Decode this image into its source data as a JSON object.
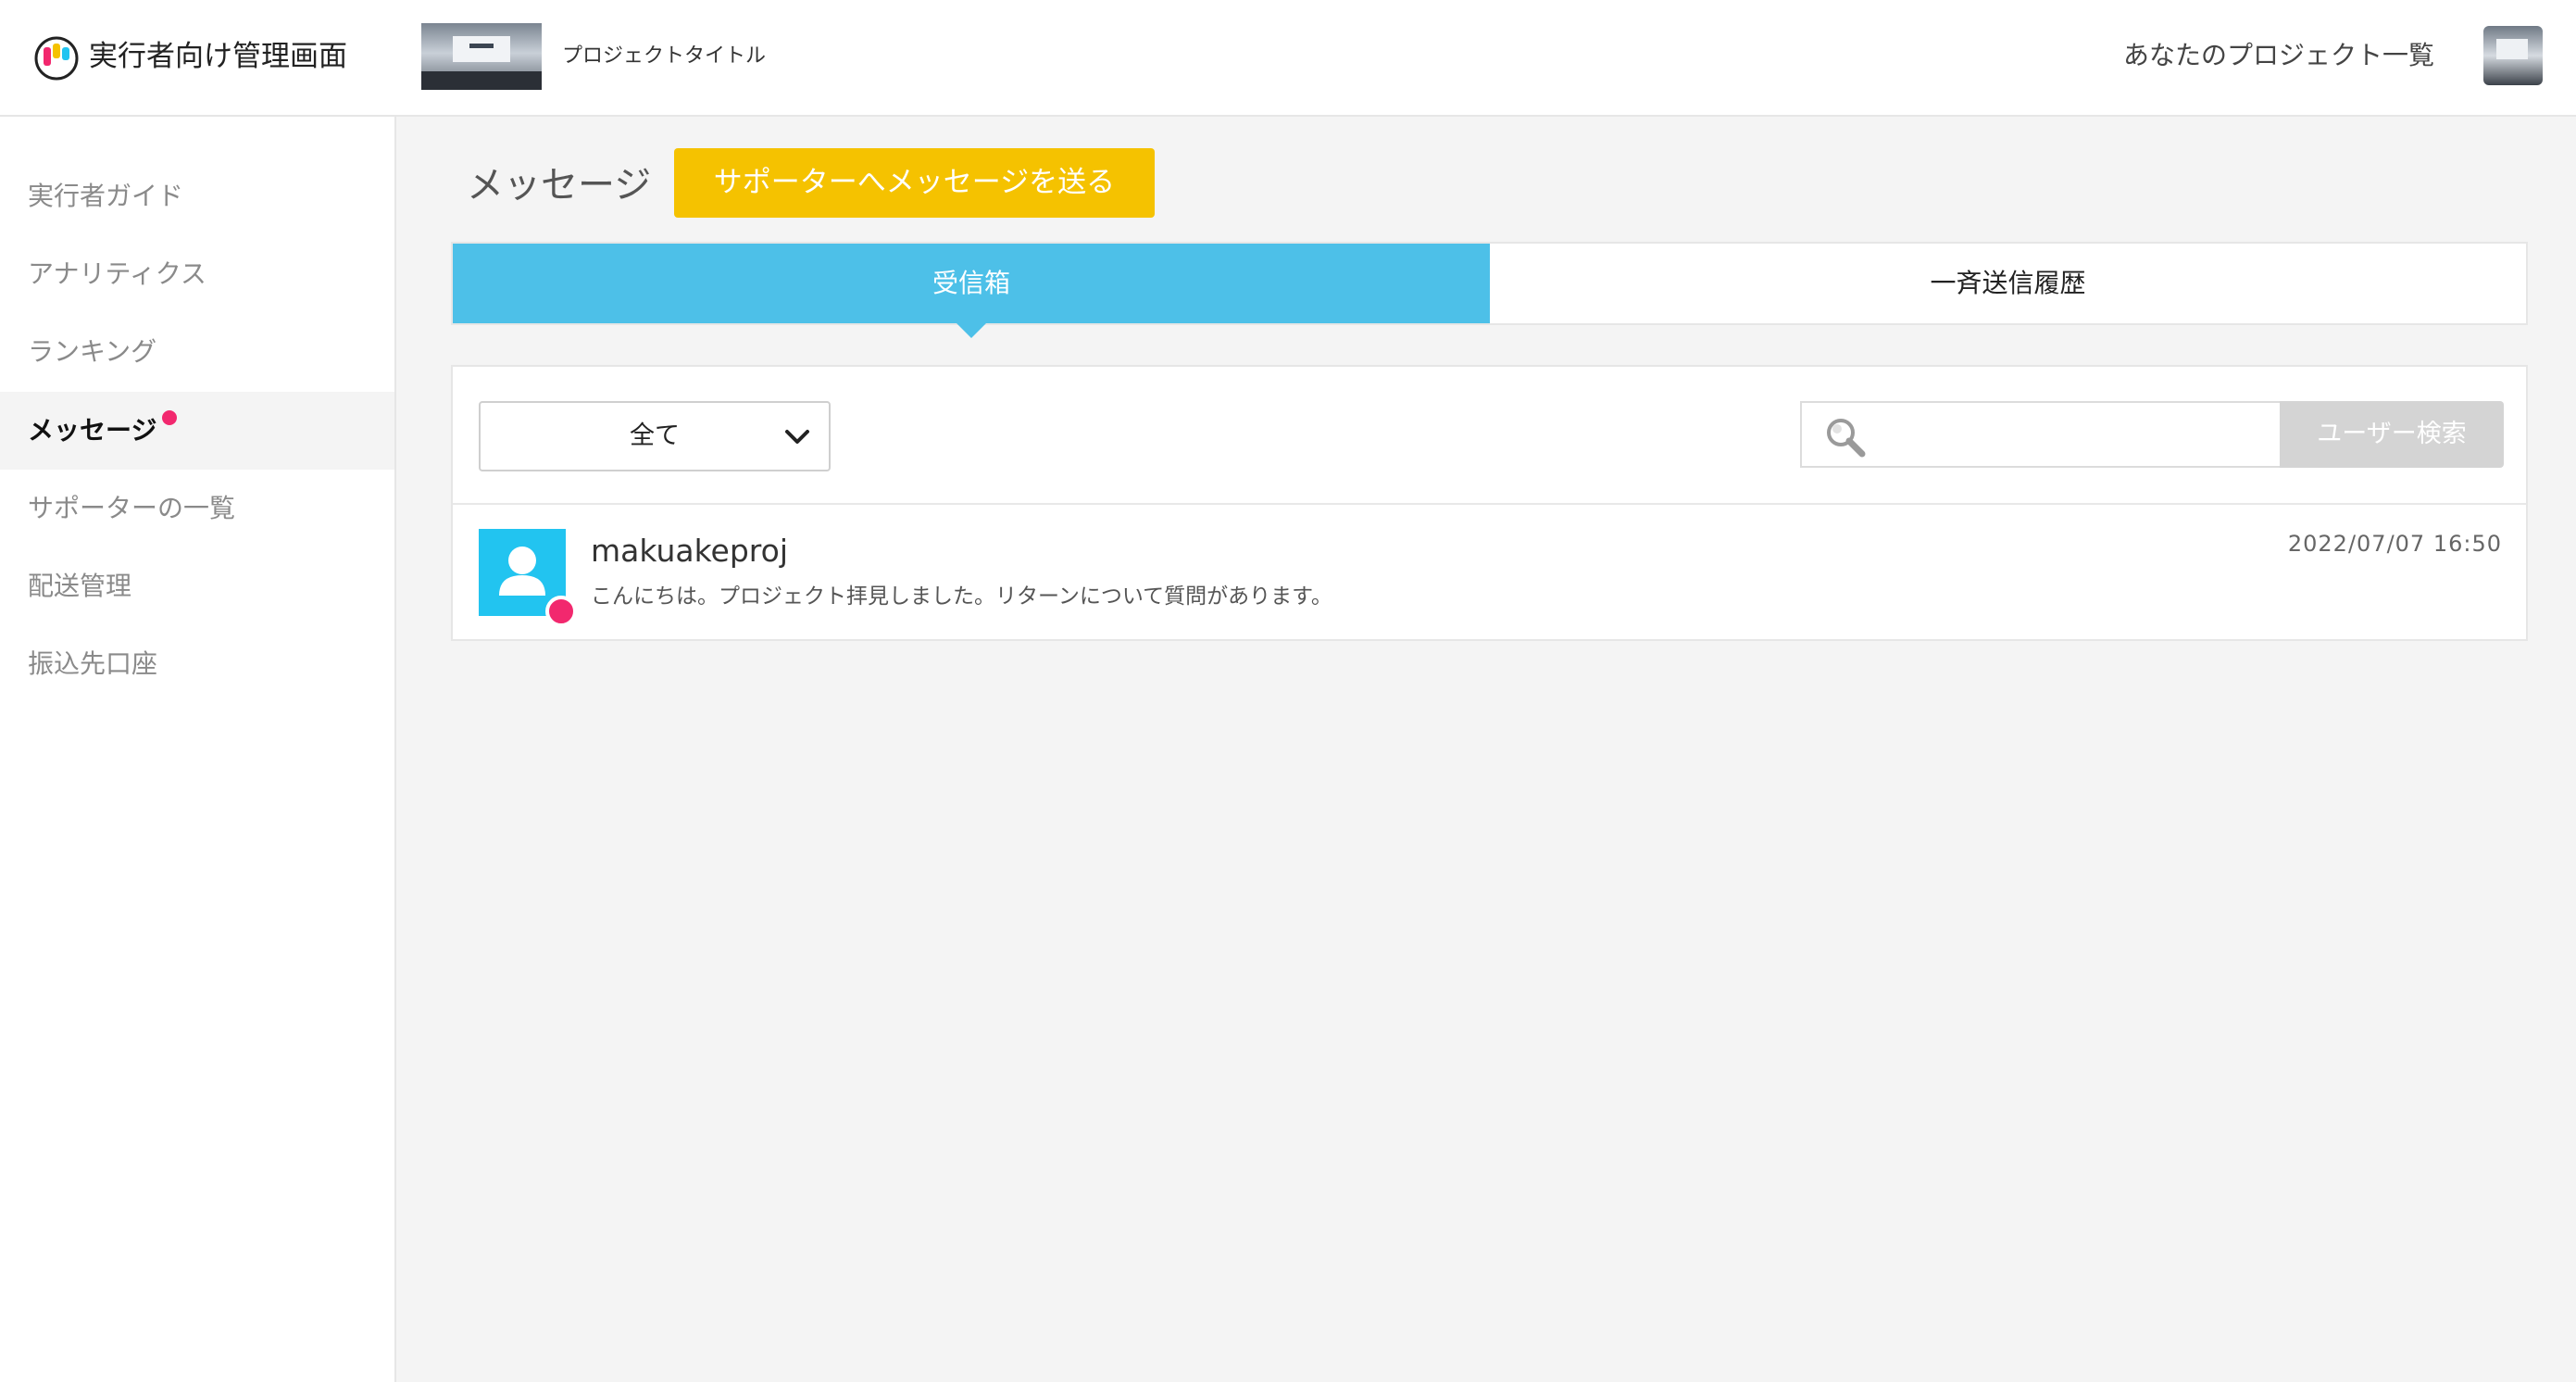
{
  "header": {
    "app_title": "実行者向け管理画面",
    "project_title": "プロジェクトタイトル",
    "projects_link": "あなたのプロジェクト一覧"
  },
  "sidebar": {
    "items": [
      {
        "label": "実行者ガイド",
        "active": false
      },
      {
        "label": "アナリティクス",
        "active": false
      },
      {
        "label": "ランキング",
        "active": false
      },
      {
        "label": "メッセージ",
        "active": true,
        "badge": true
      },
      {
        "label": "サポーターの一覧",
        "active": false
      },
      {
        "label": "配送管理",
        "active": false
      },
      {
        "label": "振込先口座",
        "active": false
      }
    ]
  },
  "main": {
    "heading": "メッセージ",
    "send_button": "サポーターへメッセージを送る",
    "tabs": [
      {
        "label": "受信箱",
        "active": true
      },
      {
        "label": "一斉送信履歴",
        "active": false
      }
    ],
    "filter": {
      "selected": "全て"
    },
    "search": {
      "value": "",
      "button_label": "ユーザー検索"
    },
    "messages": [
      {
        "name": "makuakeproj",
        "preview": "こんにちは。プロジェクト拝見しました。リターンについて質問があります。",
        "timestamp": "2022/07/07 16:50",
        "unread": true
      }
    ]
  },
  "colors": {
    "accent_blue": "#4dc0e8",
    "button_yellow": "#f5c200",
    "unread_pink": "#f2286e",
    "avatar_cyan": "#22c4f0"
  },
  "icons": {
    "logo": "brand-logo-icon",
    "dropdown": "chevron-down-icon",
    "search": "search-icon",
    "user": "user-icon"
  }
}
